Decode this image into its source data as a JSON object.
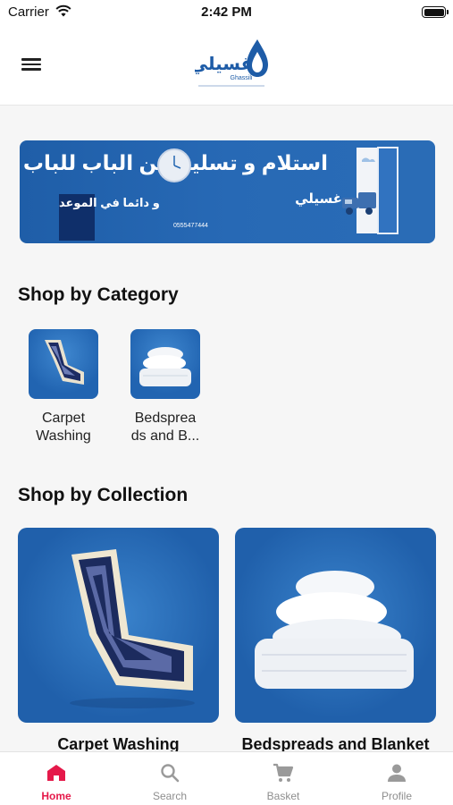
{
  "status_bar": {
    "carrier": "Carrier",
    "time": "2:42 PM"
  },
  "header": {
    "logo_arabic": "غسيلي",
    "logo_latin": "Ghassili"
  },
  "banner": {
    "line1": "استلام و تسليم من الباب للباب",
    "line2": "و دائما في الموعد",
    "brand": "غسيلي",
    "phone": "0555477444"
  },
  "shop_by_category": {
    "title": "Shop by Category",
    "items": [
      {
        "label": "Carpet Washing",
        "line1": "Carpet",
        "line2": "Washing"
      },
      {
        "label": "Bedspreads and B...",
        "line1": "Bedsprea",
        "line2": "ds and B..."
      }
    ]
  },
  "shop_by_collection": {
    "title": "Shop by Collection",
    "items": [
      {
        "label": "Carpet Washing"
      },
      {
        "label": "Bedspreads and Blanket"
      }
    ]
  },
  "bottom_nav": {
    "items": [
      {
        "label": "Home",
        "icon": "home-icon",
        "active": true
      },
      {
        "label": "Search",
        "icon": "search-icon",
        "active": false
      },
      {
        "label": "Basket",
        "icon": "cart-icon",
        "active": false
      },
      {
        "label": "Profile",
        "icon": "person-icon",
        "active": false
      }
    ]
  },
  "colors": {
    "accent": "#e5194a",
    "brand_blue": "#2466b2"
  }
}
